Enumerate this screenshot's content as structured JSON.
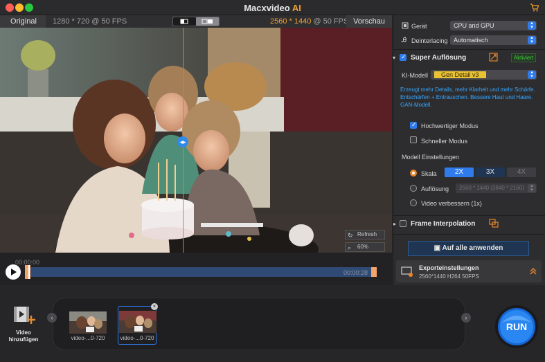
{
  "window": {
    "app_name": "Macxvideo",
    "app_suffix": "AI"
  },
  "preview": {
    "original_label": "Original",
    "original_res": "1280 * 720 @ 50 FPS",
    "output_res_hl": "2560 * 1440",
    "output_res_rest": " @ 50 FPS",
    "preview_label": "Vorschau",
    "refresh_label": "Refresh",
    "zoom_label": "60%"
  },
  "timeline": {
    "time_start": "00:00:00",
    "time_end": "00:00:28"
  },
  "settings": {
    "device_label": "Gerät",
    "device_value": "CPU and GPU",
    "deinterlace_label": "Deinterlacing",
    "deinterlace_value": "Automatisch",
    "super_label": "Super Auflösung",
    "activated_label": "Aktiviert",
    "ki_label": "KI-Modell",
    "ki_value": "Gen Detail v3",
    "info_text": "Erzeugt mehr Details, mehr Klarheit und mehr Schärfe. Entschärfen + Entrauschen. Bessere Haut und Haare. GAN-Modell.",
    "hq_label": "Hochwertiger Modus",
    "fast_label": "Schneller Modus",
    "model_settings_label": "Modell Einstellungen",
    "scale_label": "Skala",
    "scale_2x": "2X",
    "scale_3x": "3X",
    "scale_4x": "4X",
    "res_label": "Auflösung",
    "res_value": "2560 * 1440 (3840 * 2160)",
    "enhance_label": "Video verbessern (1x)",
    "frame_interp_label": "Frame Interpolation",
    "apply_all_label": "Auf alle anwenden",
    "export_title": "Exporteinstellungen",
    "export_detail": "2560*1440  H264  50FPS"
  },
  "bottom": {
    "add_video_label_1": "Video",
    "add_video_label_2": "hinzufügen",
    "clips": [
      {
        "label": "video-...0-720"
      },
      {
        "label": "video-...0-720"
      }
    ],
    "run_label": "RUN"
  },
  "colors": {
    "accent_orange": "#f0a034",
    "accent_blue": "#2f7bec",
    "info_blue": "#36a6ff",
    "activated_green": "#3fcf3a",
    "ki_yellow": "#e8c233"
  }
}
